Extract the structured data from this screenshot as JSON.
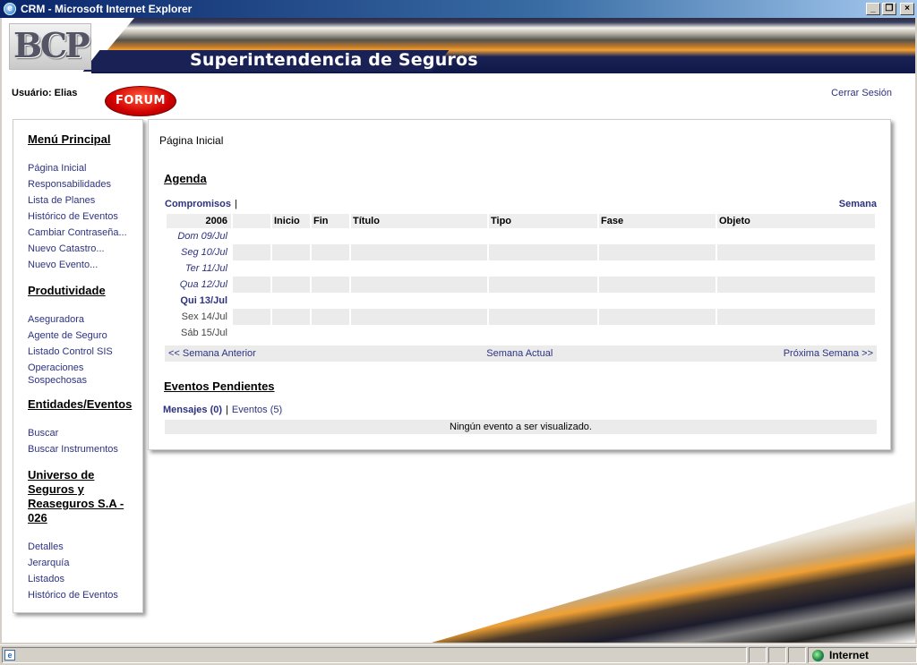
{
  "window": {
    "title": "CRM - Microsoft Internet Explorer",
    "min": "_",
    "max": "❐",
    "close": "×",
    "ie_glyph": "e"
  },
  "header": {
    "logo_text": "BCP",
    "site_title": "Superintendencia de Seguros"
  },
  "topbar": {
    "user": "Usuário: Elias",
    "forum": "FORUM",
    "logout": "Cerrar Sesión"
  },
  "sidebar": {
    "groups": [
      {
        "title": "Menú Principal",
        "items": [
          "Página Inicial",
          "Responsabilidades",
          "Lista de Planes",
          "Histórico de Eventos",
          "Cambiar Contraseña...",
          "Nuevo Catastro...",
          "Nuevo Evento..."
        ]
      },
      {
        "title": "Produtividade",
        "items": [
          "Aseguradora",
          "Agente de Seguro",
          "Listado Control SIS",
          "Operaciones Sospechosas"
        ]
      },
      {
        "title": "Entidades/Eventos",
        "items": [
          "Buscar",
          "Buscar Instrumentos"
        ]
      },
      {
        "title": "Universo de Seguros y Reaseguros S.A - 026",
        "items": [
          "Detalles",
          "Jerarquía",
          "Listados",
          "Histórico de Eventos"
        ]
      }
    ]
  },
  "main": {
    "breadcrumb": "Página Inicial",
    "agenda": {
      "title": "Agenda",
      "tab_compromisos": "Compromisos",
      "separator": "|",
      "semana": "Semana",
      "columns": [
        "2006",
        "Inicio",
        "Fin",
        "Título",
        "Tipo",
        "Fase",
        "Objeto"
      ],
      "days": [
        "Dom 09/Jul",
        "Seg 10/Jul",
        "Ter 11/Jul",
        "Qua 12/Jul",
        "Qui 13/Jul",
        "Sex 14/Jul",
        "Sáb 15/Jul"
      ],
      "nav_prev": "<< Semana Anterior",
      "nav_current": "Semana Actual",
      "nav_next": "Próxima Semana >>"
    },
    "events": {
      "title": "Eventos Pendientes",
      "tab_mensajes": "Mensajes (0)",
      "separator": "|",
      "tab_eventos": "Eventos (5)",
      "empty": "Ningún evento a ser visualizado."
    }
  },
  "statusbar": {
    "page_glyph": "e",
    "zone": "Internet"
  }
}
